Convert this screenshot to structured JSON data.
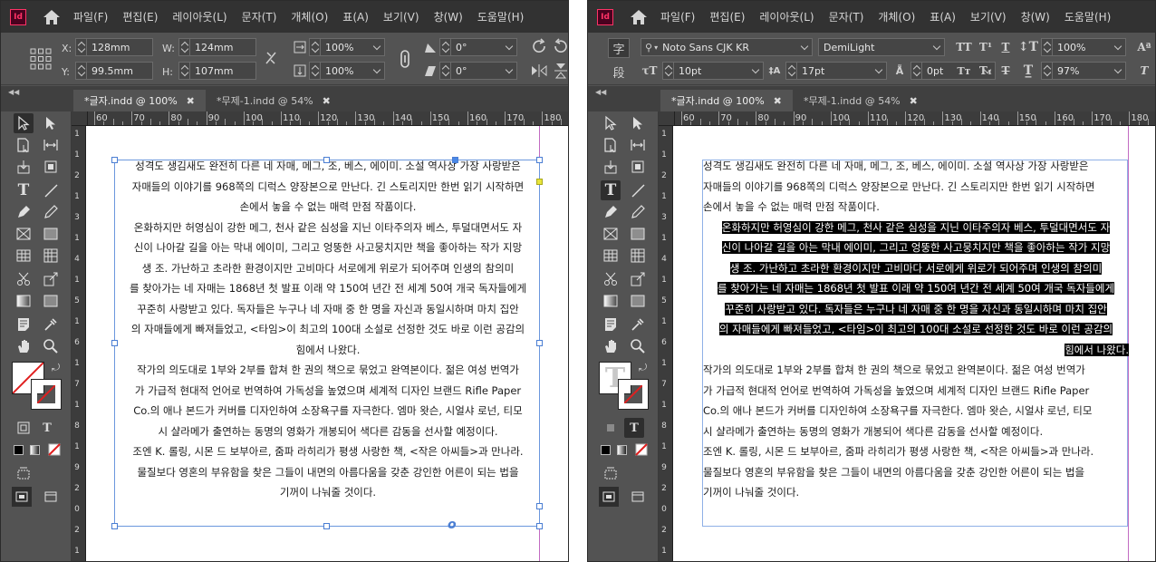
{
  "menu": {
    "app_logo": "Id",
    "items": [
      "파일(F)",
      "편집(E)",
      "레이아웃(L)",
      "문자(T)",
      "개체(O)",
      "표(A)",
      "보기(V)",
      "창(W)",
      "도움말(H)"
    ]
  },
  "left": {
    "control": {
      "x_label": "X:",
      "x_value": "128mm",
      "y_label": "Y:",
      "y_value": "99.5mm",
      "w_label": "W:",
      "w_value": "124mm",
      "h_label": "H:",
      "h_value": "107mm",
      "scale_x": "100%",
      "scale_y": "100%",
      "rotate": "0°",
      "shear": "0°"
    },
    "tabs": [
      {
        "label": "*글자.indd @ 100%",
        "active": true
      },
      {
        "label": "*무제-1.indd @ 54%",
        "active": false
      }
    ]
  },
  "right": {
    "control": {
      "char_label": "字",
      "para_label": "段",
      "font_family": "Noto Sans CJK KR",
      "font_style": "DemiLight",
      "size": "10pt",
      "leading": "17pt",
      "tracking": "0pt",
      "vscale": "100%",
      "hscale": "97%"
    },
    "tabs": [
      {
        "label": "*글자.indd @ 100%",
        "active": true
      },
      {
        "label": "*무제-1.indd @ 54%",
        "active": false
      }
    ]
  },
  "ruler": {
    "h_labels": [
      "60",
      "70",
      "80",
      "90",
      "100",
      "110",
      "120",
      "130",
      "140",
      "150",
      "160",
      "170",
      "180",
      "190"
    ],
    "v_labels": [
      "1",
      "1",
      "2",
      "1",
      "3",
      "1",
      "4",
      "1",
      "5",
      "1",
      "6",
      "1",
      "7",
      "1",
      "8",
      "1",
      "9",
      "2",
      "0",
      "2",
      "1"
    ]
  },
  "body_text": {
    "p1": [
      "성격도 생김새도 완전히 다른 네 자매, 메그, 조, 베스, 에이미. 소설 역사상 가장 사랑받은",
      "자매들의 이야기를 968쪽의 디럭스 양장본으로 만난다. 긴 스토리지만 한번 읽기 시작하면",
      "손에서 놓을 수 없는 매력 만점 작품이다."
    ],
    "p2": [
      "온화하지만 허영심이 강한 메그, 천사 같은 심성을 지닌 이타주의자 베스, 투덜대면서도 자",
      "신이 나아갈 길을 아는 막내 에이미, 그리고 엉뚱한 사고뭉치지만 책을 좋아하는 작가 지망",
      "생 조. 가난하고 초라한 환경이지만 고비마다 서로에게 위로가 되어주며 인생의 참의미",
      "를 찾아가는 네 자매는 1868년 첫 발표 이래 약 150여 년간 전 세계 50여 개국 독자들에게",
      "꾸준히 사랑받고 있다. 독자들은 누구나 네 자매 중 한 명을 자신과 동일시하며 마치 집안",
      "의 자매들에게 빠져들었고, <타임>이 최고의 100대 소설로 선정한 것도 바로 이런 공감의",
      "힘에서 나왔다."
    ],
    "p3": [
      "작가의 의도대로 1부와 2부를 합쳐 한 권의 책으로 묶었고 완역본이다. 젊은 여성 번역가",
      "가 가급적 현대적 언어로 번역하여 가독성을 높였으며 세계적 디자인 브랜드 Rifle Paper",
      "Co.의 애나 본드가 커버를 디자인하여 소장욕구를 자극한다. 엠마 왓슨, 시얼샤 로넌, 티모",
      "시 샬라메가 출연하는 동명의 영화가 개봉되어 색다른 감동을 선사할 예정이다."
    ],
    "p4": [
      "조엔 K. 롤링, 시몬 드 보부아르, 줌파 라히리가 평생 사랑한 책, <작은 아씨들>과 만나라.",
      "물질보다 영혼의 부유함을 찾은 그들이 내면의 아름다움을 갖춘 강인한 어른이 되는 법을",
      "기꺼이 나눠줄 것이다."
    ]
  },
  "colors": {
    "app_bg": "#535353",
    "menubar_bg": "#323232",
    "frame_border": "#6b97dd",
    "bleed_guide": "#c26bc2",
    "highlight": "#000000"
  },
  "icons": [
    "home-icon",
    "selection-tool-icon",
    "direct-selection-tool-icon",
    "type-tool-icon",
    "pen-tool-icon",
    "rectangle-frame-tool-icon",
    "scissors-tool-icon",
    "gradient-tool-icon",
    "hand-tool-icon",
    "zoom-tool-icon",
    "fill-stroke-icon",
    "chain-link-icon"
  ]
}
